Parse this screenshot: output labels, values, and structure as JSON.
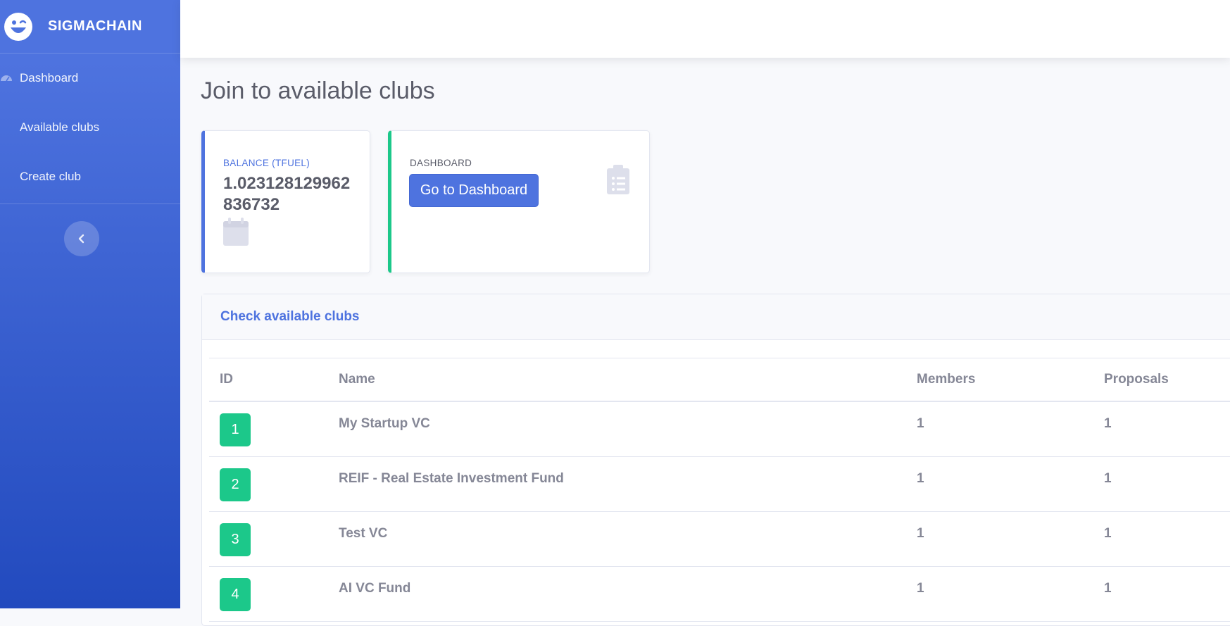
{
  "brand": {
    "name": "SIGMACHAIN",
    "icon": "laugh-wink-icon"
  },
  "sidebar": {
    "items": [
      {
        "label": "Dashboard",
        "icon": "tachometer-icon"
      },
      {
        "label": "Available clubs"
      },
      {
        "label": "Create club"
      }
    ],
    "toggle_icon": "chevron-left-icon"
  },
  "page": {
    "title": "Join to available clubs"
  },
  "cards": {
    "balance": {
      "label": "BALANCE (TFUEL)",
      "value": "1.023128129962836732",
      "icon": "calendar-icon"
    },
    "dashboard": {
      "label": "DASHBOARD",
      "button": "Go to Dashboard",
      "icon": "clipboard-list-icon"
    }
  },
  "clubs": {
    "title": "Check available clubs",
    "columns": [
      "ID",
      "Name",
      "Members",
      "Proposals"
    ],
    "rows": [
      {
        "id": "1",
        "name": "My Startup VC",
        "members": "1",
        "proposals": "1"
      },
      {
        "id": "2",
        "name": "REIF - Real Estate Investment Fund",
        "members": "1",
        "proposals": "1"
      },
      {
        "id": "3",
        "name": "Test VC",
        "members": "1",
        "proposals": "1"
      },
      {
        "id": "4",
        "name": "AI VC Fund",
        "members": "1",
        "proposals": "1"
      }
    ]
  },
  "colors": {
    "primary": "#4e73df",
    "success": "#1cc88a",
    "text": "#858796",
    "heading": "#5a5c69"
  }
}
